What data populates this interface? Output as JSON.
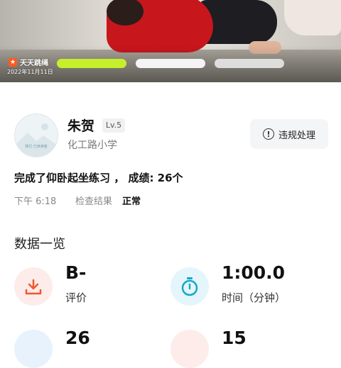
{
  "video": {
    "logo_text": "天天跳绳",
    "date": "2022年11月11日",
    "progress": [
      1.0,
      0.0,
      0.0
    ]
  },
  "profile": {
    "name": "朱贺",
    "level": "Lv.5",
    "school": "化工路小学",
    "avatar_caption": "我们 已读读者"
  },
  "actions": {
    "violation_label": "违规处理",
    "violation_icon": "exclamation-circle-icon"
  },
  "record": {
    "summary": "完成了仰卧起坐练习 ， 成绩: 26个",
    "time": "下午 6:18",
    "check_label": "检查结果",
    "check_status": "正常"
  },
  "data_overview": {
    "title": "数据一览",
    "stats": [
      {
        "value": "B-",
        "label": "评价",
        "icon": "rating-icon",
        "accent": "#f0582f"
      },
      {
        "value": "1:00.0",
        "label": "时间（分钟）",
        "icon": "stopwatch-icon",
        "accent": "#17a7c9"
      },
      {
        "value": "26",
        "label": "",
        "icon": "count-icon",
        "accent": "#2f8de0"
      },
      {
        "value": "15",
        "label": "",
        "icon": "extra-icon",
        "accent": "#f0582f"
      }
    ]
  }
}
